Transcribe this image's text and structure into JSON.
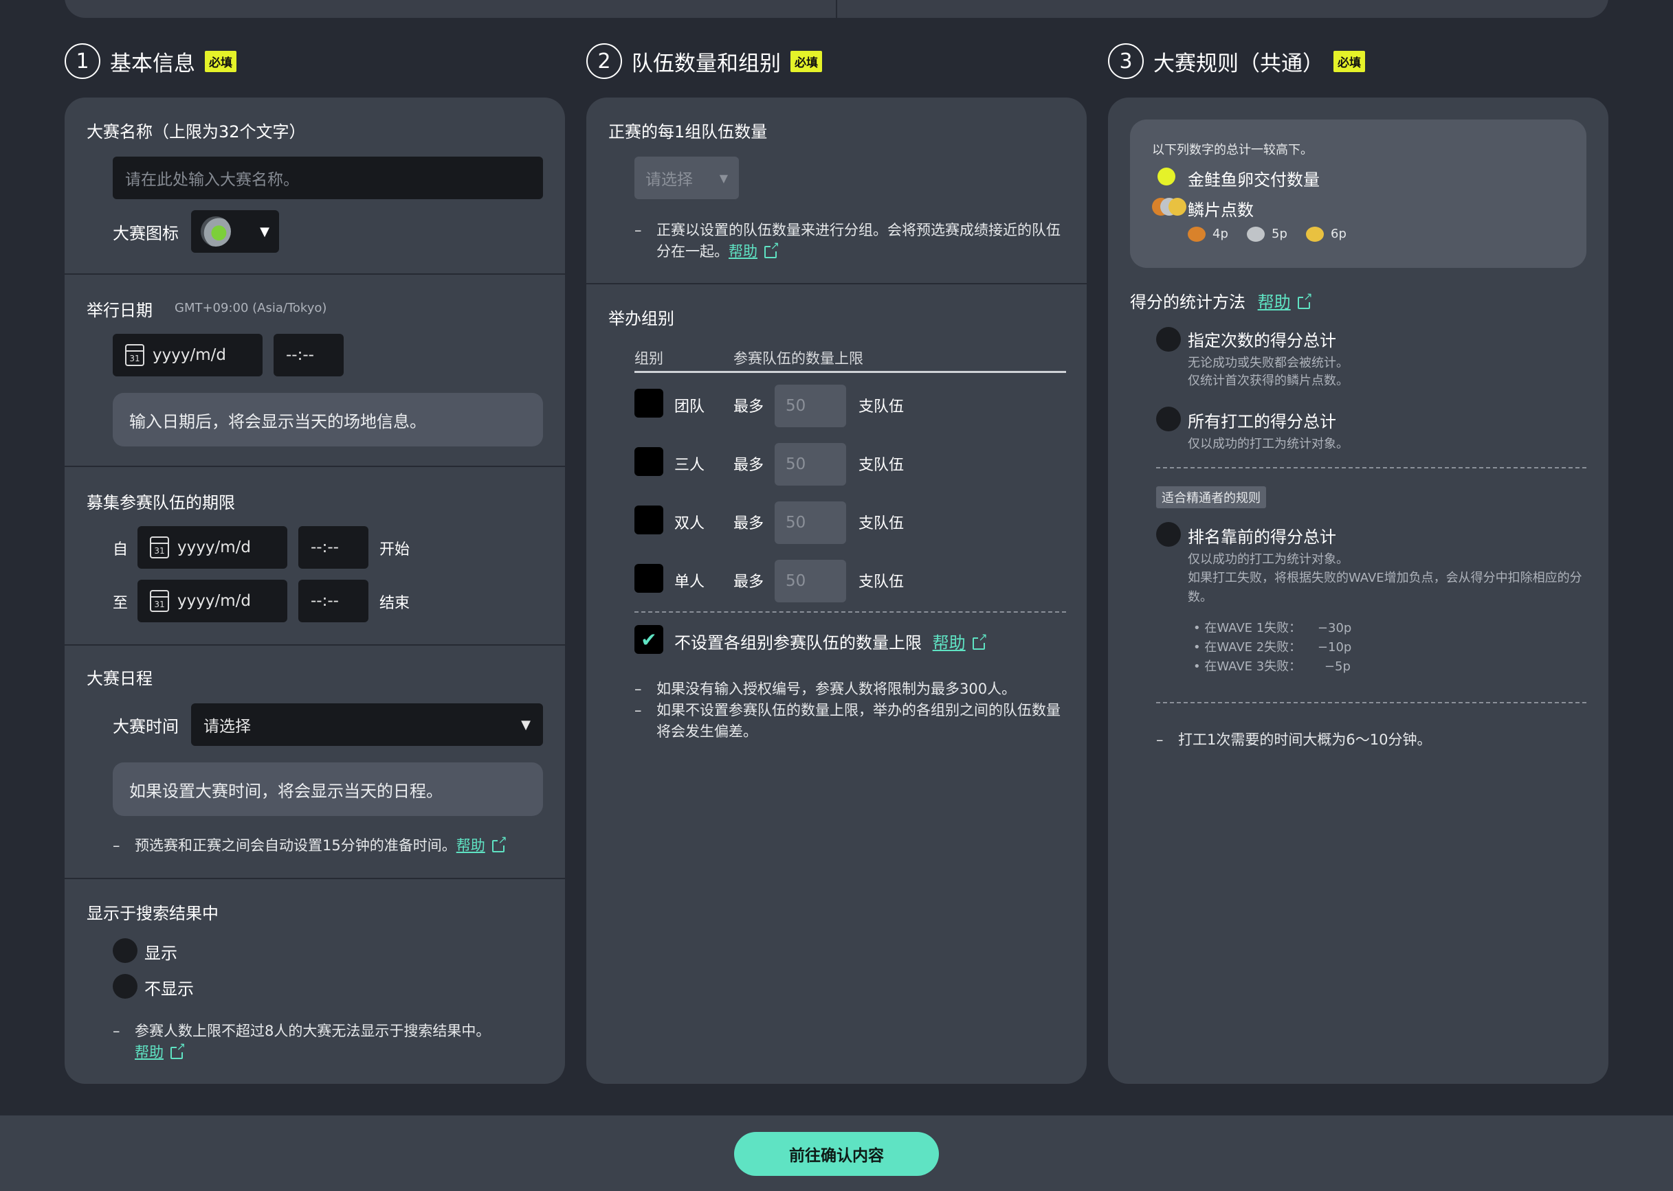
{
  "sections": [
    {
      "num": "1",
      "title": "基本信息",
      "badge": "必填"
    },
    {
      "num": "2",
      "title": "队伍数量和组别",
      "badge": "必填"
    },
    {
      "num": "3",
      "title": "大赛规则（共通）",
      "badge": "必填"
    }
  ],
  "basic": {
    "name_label": "大赛名称（上限为32个文字）",
    "name_placeholder": "请在此处输入大赛名称。",
    "icon_label": "大赛图标",
    "date_label": "举行日期",
    "timezone": "GMT+09:00 (Asia/Tokyo)",
    "date_placeholder": "yyyy/m/d",
    "time_placeholder": "--:--",
    "date_info": "输入日期后，将会显示当天的场地信息。",
    "recruit_label": "募集参赛队伍的期限",
    "from": "自",
    "to": "至",
    "start": "开始",
    "end": "结束",
    "schedule_label": "大赛日程",
    "time_label": "大赛时间",
    "time_select": "请选择",
    "schedule_info": "如果设置大赛时间，将会显示当天的日程。",
    "prep_note": "预选赛和正赛之间会自动设置15分钟的准备时间。",
    "help": "帮助",
    "search_label": "显示于搜索结果中",
    "show": "显示",
    "hide": "不显示",
    "search_note": "参赛人数上限不超过8人的大赛无法显示于搜索结果中。",
    "calendar_day": "31"
  },
  "teams": {
    "per_group_label": "正赛的每1组队伍数量",
    "per_group_select": "请选择",
    "per_group_note": "正赛以设置的队伍数量来进行分组。会将预选赛成绩接近的队伍分在一起。",
    "help": "帮助",
    "divisions_label": "举办组别",
    "col_division": "组别",
    "col_limit": "参赛队伍的数量上限",
    "rows": [
      {
        "name": "团队",
        "max": "最多",
        "value": "50",
        "unit": "支队伍"
      },
      {
        "name": "三人",
        "max": "最多",
        "value": "50",
        "unit": "支队伍"
      },
      {
        "name": "双人",
        "max": "最多",
        "value": "50",
        "unit": "支队伍"
      },
      {
        "name": "单人",
        "max": "最多",
        "value": "50",
        "unit": "支队伍"
      }
    ],
    "no_limit_label": "不设置各组别参赛队伍的数量上限",
    "note1": "如果没有输入授权编号，参赛人数将限制为最多300人。",
    "note2": "如果不设置参赛队伍的数量上限，举办的各组别之间的队伍数量将会发生偏差。",
    "checkmark": "✔"
  },
  "rules": {
    "compare_text": "以下列数字的总计一较高下。",
    "golden_eggs": "金鲑鱼卵交付数量",
    "scales": "鳞片点数",
    "scale_points": [
      "4p",
      "5p",
      "6p"
    ],
    "method_label": "得分的统计方法",
    "help": "帮助",
    "opt1_title": "指定次数的得分总计",
    "opt1_desc1": "无论成功或失败都会被统计。",
    "opt1_desc2": "仅统计首次获得的鳞片点数。",
    "opt2_title": "所有打工的得分总计",
    "opt2_desc": "仅以成功的打工为统计对象。",
    "expert_tag": "适合精通者的规则",
    "opt3_title": "排名靠前的得分总计",
    "opt3_desc1": "仅以成功的打工为统计对象。",
    "opt3_desc2": "如果打工失败，将根据失败的WAVE增加负点，会从得分中扣除相应的分数。",
    "penalties": [
      {
        "label": "在WAVE 1失败：",
        "value": "−30p"
      },
      {
        "label": "在WAVE 2失败：",
        "value": "−10p"
      },
      {
        "label": "在WAVE 3失败：",
        "value": "−5p"
      }
    ],
    "time_note": "打工1次需要的时间大概为6〜10分钟。"
  },
  "footer": {
    "confirm": "前往确认内容"
  },
  "colors": {
    "accent": "#5fe3c3",
    "badge": "#e5f229",
    "panel": "#3c424c",
    "bg": "#262a33"
  },
  "icons": [
    "calendar-icon",
    "external-link-icon",
    "dropdown-arrow-icon",
    "check-icon",
    "golden-egg-icon",
    "scale-icon"
  ]
}
